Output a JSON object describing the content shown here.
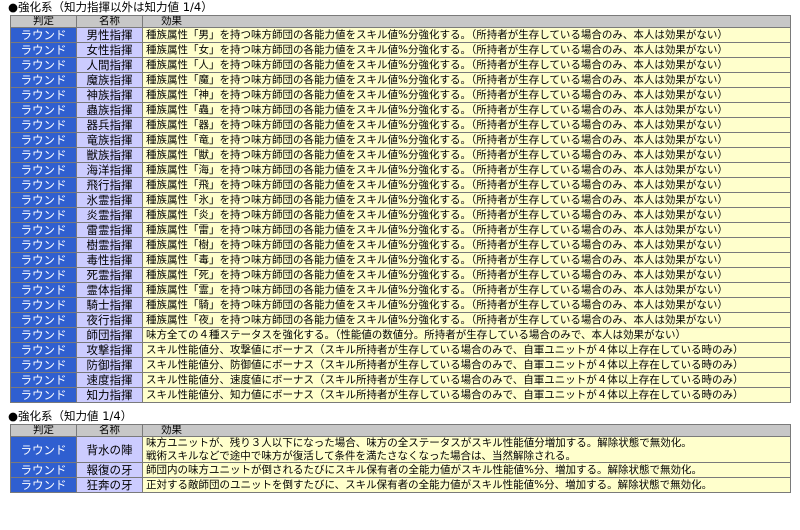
{
  "sections": [
    {
      "title": "●強化系（知力指揮以外は知力値 1/4）",
      "headers": [
        "判定",
        "名称",
        "効果"
      ],
      "rows": [
        {
          "category": "ラウンド",
          "name": "男性指揮",
          "effect": "種族属性「男」を持つ味方師団の各能力値をスキル値%分強化する。（所持者が生存している場合のみ、本人は効果がない）"
        },
        {
          "category": "ラウンド",
          "name": "女性指揮",
          "effect": "種族属性「女」を持つ味方師団の各能力値をスキル値%分強化する。（所持者が生存している場合のみ、本人は効果がない）"
        },
        {
          "category": "ラウンド",
          "name": "人間指揮",
          "effect": "種族属性「人」を持つ味方師団の各能力値をスキル値%分強化する。（所持者が生存している場合のみ、本人は効果がない）"
        },
        {
          "category": "ラウンド",
          "name": "魔族指揮",
          "effect": "種族属性「魔」を持つ味方師団の各能力値をスキル値%分強化する。（所持者が生存している場合のみ、本人は効果がない）"
        },
        {
          "category": "ラウンド",
          "name": "神族指揮",
          "effect": "種族属性「神」を持つ味方師団の各能力値をスキル値%分強化する。（所持者が生存している場合のみ、本人は効果がない）"
        },
        {
          "category": "ラウンド",
          "name": "蟲族指揮",
          "effect": "種族属性「蟲」を持つ味方師団の各能力値をスキル値%分強化する。（所持者が生存している場合のみ、本人は効果がない）"
        },
        {
          "category": "ラウンド",
          "name": "器兵指揮",
          "effect": "種族属性「器」を持つ味方師団の各能力値をスキル値%分強化する。（所持者が生存している場合のみ、本人は効果がない）"
        },
        {
          "category": "ラウンド",
          "name": "竜族指揮",
          "effect": "種族属性「竜」を持つ味方師団の各能力値をスキル値%分強化する。（所持者が生存している場合のみ、本人は効果がない）"
        },
        {
          "category": "ラウンド",
          "name": "獣族指揮",
          "effect": "種族属性「獣」を持つ味方師団の各能力値をスキル値%分強化する。（所持者が生存している場合のみ、本人は効果がない）"
        },
        {
          "category": "ラウンド",
          "name": "海洋指揮",
          "effect": "種族属性「海」を持つ味方師団の各能力値をスキル値%分強化する。（所持者が生存している場合のみ、本人は効果がない）"
        },
        {
          "category": "ラウンド",
          "name": "飛行指揮",
          "effect": "種族属性「飛」を持つ味方師団の各能力値をスキル値%分強化する。（所持者が生存している場合のみ、本人は効果がない）"
        },
        {
          "category": "ラウンド",
          "name": "氷霊指揮",
          "effect": "種族属性「氷」を持つ味方師団の各能力値をスキル値%分強化する。（所持者が生存している場合のみ、本人は効果がない）"
        },
        {
          "category": "ラウンド",
          "name": "炎霊指揮",
          "effect": "種族属性「炎」を持つ味方師団の各能力値をスキル値%分強化する。（所持者が生存している場合のみ、本人は効果がない）"
        },
        {
          "category": "ラウンド",
          "name": "雷霊指揮",
          "effect": "種族属性「雷」を持つ味方師団の各能力値をスキル値%分強化する。（所持者が生存している場合のみ、本人は効果がない）"
        },
        {
          "category": "ラウンド",
          "name": "樹霊指揮",
          "effect": "種族属性「樹」を持つ味方師団の各能力値をスキル値%分強化する。（所持者が生存している場合のみ、本人は効果がない）"
        },
        {
          "category": "ラウンド",
          "name": "毒性指揮",
          "effect": "種族属性「毒」を持つ味方師団の各能力値をスキル値%分強化する。（所持者が生存している場合のみ、本人は効果がない）"
        },
        {
          "category": "ラウンド",
          "name": "死霊指揮",
          "effect": "種族属性「死」を持つ味方師団の各能力値をスキル値%分強化する。（所持者が生存している場合のみ、本人は効果がない）"
        },
        {
          "category": "ラウンド",
          "name": "霊体指揮",
          "effect": "種族属性「霊」を持つ味方師団の各能力値をスキル値%分強化する。（所持者が生存している場合のみ、本人は効果がない）"
        },
        {
          "category": "ラウンド",
          "name": "騎士指揮",
          "effect": "種族属性「騎」を持つ味方師団の各能力値をスキル値%分強化する。（所持者が生存している場合のみ、本人は効果がない）"
        },
        {
          "category": "ラウンド",
          "name": "夜行指揮",
          "effect": "種族属性「夜」を持つ味方師団の各能力値をスキル値%分強化する。（所持者が生存している場合のみ、本人は効果がない）"
        },
        {
          "category": "ラウンド",
          "name": "師団指揮",
          "effect": "味方全ての４種ステータスを強化する。（性能値の数値分。所持者が生存している場合のみで、本人は効果がない）"
        },
        {
          "category": "ラウンド",
          "name": "攻撃指揮",
          "effect": "スキル性能値分、攻撃値にボーナス（スキル所持者が生存している場合のみで、自軍ユニットが４体以上存在している時のみ）"
        },
        {
          "category": "ラウンド",
          "name": "防御指揮",
          "effect": "スキル性能値分、防御値にボーナス（スキル所持者が生存している場合のみで、自軍ユニットが４体以上存在している時のみ）"
        },
        {
          "category": "ラウンド",
          "name": "速度指揮",
          "effect": "スキル性能値分、速度値にボーナス（スキル所持者が生存している場合のみで、自軍ユニットが４体以上存在している時のみ）"
        },
        {
          "category": "ラウンド",
          "name": "知力指揮",
          "effect": "スキル性能値分、知力値にボーナス（スキル所持者が生存している場合のみで、自軍ユニットが４体以上存在している時のみ）"
        }
      ]
    },
    {
      "title": "●強化系（知力値 1/4）",
      "headers": [
        "判定",
        "名称",
        "効果"
      ],
      "rows": [
        {
          "category": "ラウンド",
          "name": "背水の陣",
          "effect_lines": [
            "味方ユニットが、残り３人以下になった場合、味方の全ステータスがスキル性能値分増加する。解除状態で無効化。",
            "戦術スキルなどで途中で味方が復活して条件を満たさなくなった場合は、当然解除される。"
          ]
        },
        {
          "category": "ラウンド",
          "name": "報復の牙",
          "effect": "師団内の味方ユニットが倒されるたびにスキル保有者の全能力値がスキル性能値%分、増加する。解除状態で無効化。"
        },
        {
          "category": "ラウンド",
          "name": "狂奔の牙",
          "effect": "正対する敵師団のユニットを倒すたびに、スキル保有者の全能力値がスキル性能値%分、増加する。解除状態で無効化。"
        }
      ]
    }
  ]
}
